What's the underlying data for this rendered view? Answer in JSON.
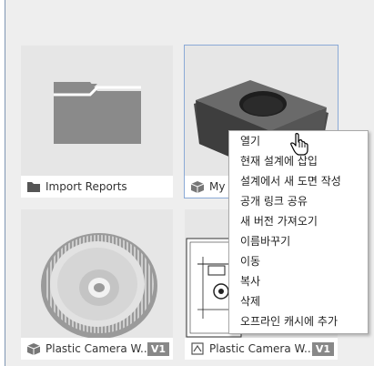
{
  "cards": [
    {
      "name": "Import Reports",
      "type": "folder",
      "badge": ""
    },
    {
      "name": "My f",
      "type": "design",
      "badge": ""
    },
    {
      "name": "Plastic Camera W...",
      "type": "design",
      "badge": "V1"
    },
    {
      "name": "Plastic Camera W...",
      "type": "drawing",
      "badge": "V1"
    }
  ],
  "context_menu": {
    "items": [
      "열기",
      "현재 설계에 삽입",
      "설계에서 새 도면 작성",
      "공개 링크 공유",
      "새 버전 가져오기",
      "이름바꾸기",
      "이동",
      "복사",
      "삭제",
      "오프라인 캐시에 추가"
    ]
  },
  "colors": {
    "folder": "#8a8a8a",
    "badge": "#888888",
    "selection": "#8aa9d6"
  },
  "icons": [
    "folder-icon",
    "cube-icon",
    "drawing-icon",
    "hand-pointer-icon"
  ]
}
